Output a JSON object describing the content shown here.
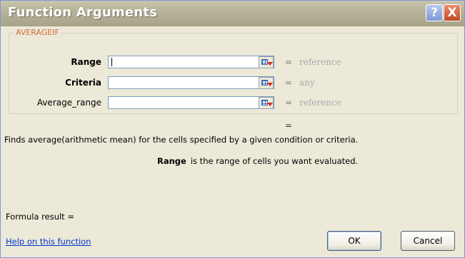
{
  "window": {
    "title": "Function Arguments",
    "help_glyph": "?",
    "close_glyph": "X"
  },
  "function_name": "AVERAGEIF",
  "arguments": [
    {
      "label": "Range",
      "value": "",
      "hint": "reference"
    },
    {
      "label": "Criteria",
      "value": "",
      "hint": "any"
    },
    {
      "label": "Average_range",
      "value": "",
      "hint": "reference"
    }
  ],
  "equals_sign": "=",
  "description": "Finds average(arithmetic mean) for the cells specified by a given condition or criteria.",
  "argument_help": {
    "name": "Range",
    "text": "is the range of cells you want evaluated."
  },
  "formula_result_label": "Formula result =",
  "help_link": "Help on this function",
  "buttons": {
    "ok": "OK",
    "cancel": "Cancel"
  }
}
